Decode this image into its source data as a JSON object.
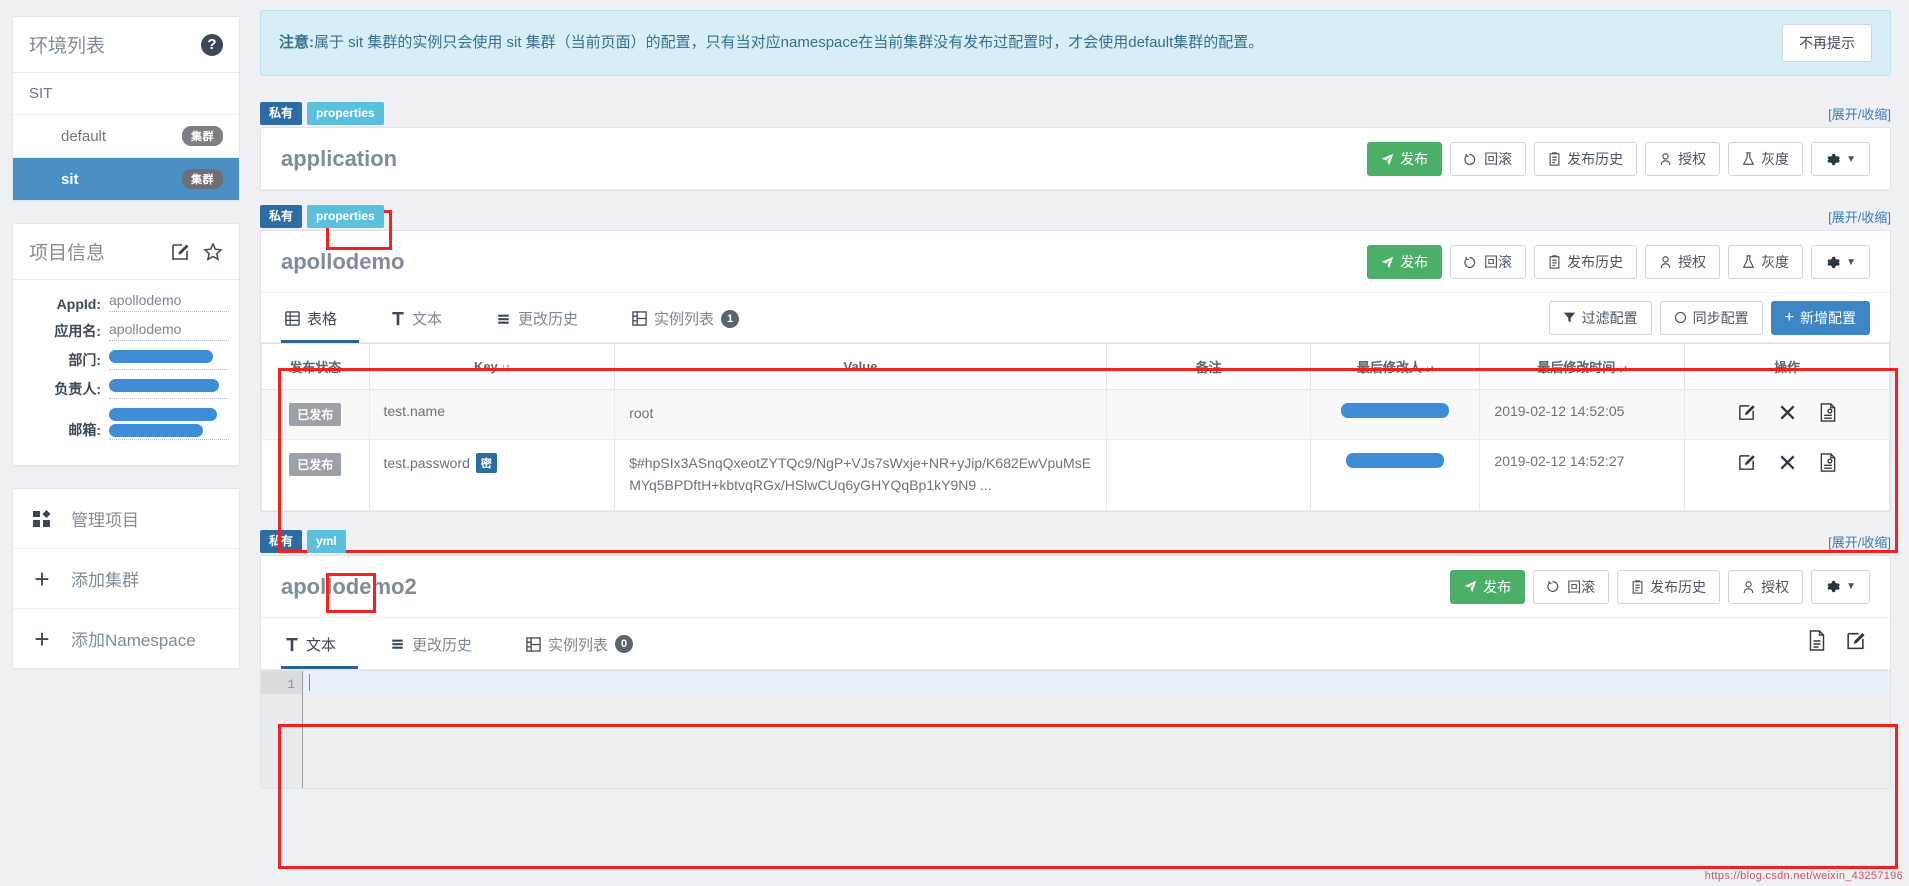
{
  "sidebar": {
    "env_panel": {
      "title": "环境列表",
      "help_icon": "question-circle-icon"
    },
    "environments": [
      {
        "label": "SIT",
        "type": "env"
      }
    ],
    "clusters": [
      {
        "label": "default",
        "tag": "集群",
        "active": false
      },
      {
        "label": "sit",
        "tag": "集群",
        "active": true
      }
    ],
    "project_panel": {
      "title": "项目信息",
      "edit_icon": "edit-square-icon",
      "favorite_icon": "star-icon",
      "fields": [
        {
          "label": "AppId:",
          "value": "apollodemo",
          "redacted": false
        },
        {
          "label": "应用名:",
          "value": "apollodemo",
          "redacted": false
        },
        {
          "label": "部门:",
          "value": "",
          "redacted": true
        },
        {
          "label": "负责人:",
          "value": "",
          "redacted": true
        },
        {
          "label": "邮箱:",
          "value": "",
          "redacted": true
        }
      ]
    },
    "nav": [
      {
        "label": "管理项目",
        "icon": "grid-blocks-icon"
      },
      {
        "label": "添加集群",
        "icon": "plus-icon"
      },
      {
        "label": "添加Namespace",
        "icon": "plus-icon"
      }
    ]
  },
  "alert": {
    "prefix": "注意:",
    "text": "属于 sit 集群的实例只会使用 sit 集群（当前页面）的配置，只有当对应namespace在当前集群没有发布过配置时，才会使用default集群的配置。",
    "dismiss_label": "不再提示"
  },
  "namespaces": [
    {
      "private_badge": "私有",
      "format_badge": "properties",
      "toggle_label": "[展开/收缩]",
      "name": "application",
      "buttons": [
        {
          "label": "发布",
          "icon": "send-icon",
          "style": "green"
        },
        {
          "label": "回滚",
          "icon": "rollback-icon",
          "style": "default"
        },
        {
          "label": "发布历史",
          "icon": "clipboard-icon",
          "style": "default"
        },
        {
          "label": "授权",
          "icon": "user-icon",
          "style": "default"
        },
        {
          "label": "灰度",
          "icon": "flask-icon",
          "style": "default"
        },
        {
          "label": "",
          "icon": "gear-caret-icon",
          "style": "default"
        }
      ]
    },
    {
      "private_badge": "私有",
      "format_badge": "properties",
      "toggle_label": "[展开/收缩]",
      "name": "apollodemo",
      "buttons": [
        {
          "label": "发布",
          "icon": "send-icon",
          "style": "green"
        },
        {
          "label": "回滚",
          "icon": "rollback-icon",
          "style": "default"
        },
        {
          "label": "发布历史",
          "icon": "clipboard-icon",
          "style": "default"
        },
        {
          "label": "授权",
          "icon": "user-icon",
          "style": "default"
        },
        {
          "label": "灰度",
          "icon": "flask-icon",
          "style": "default"
        },
        {
          "label": "",
          "icon": "gear-caret-icon",
          "style": "default"
        }
      ],
      "tabs": [
        {
          "label": "表格",
          "icon": "table-icon",
          "active": true,
          "badge": null
        },
        {
          "label": "文本",
          "icon": "text-T-icon",
          "active": false,
          "badge": null
        },
        {
          "label": "更改历史",
          "icon": "history-icon",
          "active": false,
          "badge": null
        },
        {
          "label": "实例列表",
          "icon": "instances-icon",
          "active": false,
          "badge": "1"
        }
      ],
      "toolbar": [
        {
          "label": "过滤配置",
          "icon": "filter-icon",
          "style": "default"
        },
        {
          "label": "同步配置",
          "icon": "sync-icon",
          "style": "default"
        },
        {
          "label": "新增配置",
          "icon": "plus-icon",
          "style": "blue"
        }
      ],
      "table": {
        "headers": [
          "发布状态",
          "Key",
          "Value",
          "备注",
          "最后修改人",
          "最后修改时间",
          "操作"
        ],
        "sortable": [
          false,
          true,
          false,
          false,
          true,
          true,
          false
        ],
        "rows": [
          {
            "state": "已发布",
            "key": "test.name",
            "secret": false,
            "value": "root",
            "remark": "",
            "modifier_redacted": true,
            "time": "2019-02-12 14:52:05",
            "ops": [
              "edit-icon",
              "delete-x-icon",
              "detail-doc-icon"
            ]
          },
          {
            "state": "已发布",
            "key": "test.password",
            "secret": true,
            "secret_badge": "密",
            "value": "$#hpSIx3ASnqQxeotZYTQc9/NgP+VJs7sWxje+NR+yJip/K682EwVpuMsEMYq5BPDftH+kbtvqRGx/HSlwCUq6yGHYQqBp1kY9N9 ...",
            "remark": "",
            "modifier_redacted": true,
            "time": "2019-02-12 14:52:27",
            "ops": [
              "edit-icon",
              "delete-x-icon",
              "detail-doc-icon"
            ]
          }
        ]
      }
    },
    {
      "private_badge": "私有",
      "format_badge": "yml",
      "toggle_label": "[展开/收缩]",
      "name": "apollodemo2",
      "buttons": [
        {
          "label": "发布",
          "icon": "send-icon",
          "style": "green"
        },
        {
          "label": "回滚",
          "icon": "rollback-icon",
          "style": "default"
        },
        {
          "label": "发布历史",
          "icon": "clipboard-icon",
          "style": "default"
        },
        {
          "label": "授权",
          "icon": "user-icon",
          "style": "default"
        },
        {
          "label": "",
          "icon": "gear-caret-icon",
          "style": "default"
        }
      ],
      "tabs": [
        {
          "label": "文本",
          "icon": "text-T-icon",
          "active": true,
          "badge": null
        },
        {
          "label": "更改历史",
          "icon": "history-icon",
          "active": false,
          "badge": null
        },
        {
          "label": "实例列表",
          "icon": "instances-icon",
          "active": false,
          "badge": "0"
        }
      ],
      "tab_actions": [
        "copy-doc-icon",
        "edit-square-icon"
      ],
      "editor": {
        "line_number": "1",
        "content": ""
      }
    }
  ],
  "watermark": "https://blog.csdn.net/weixin_43257196"
}
